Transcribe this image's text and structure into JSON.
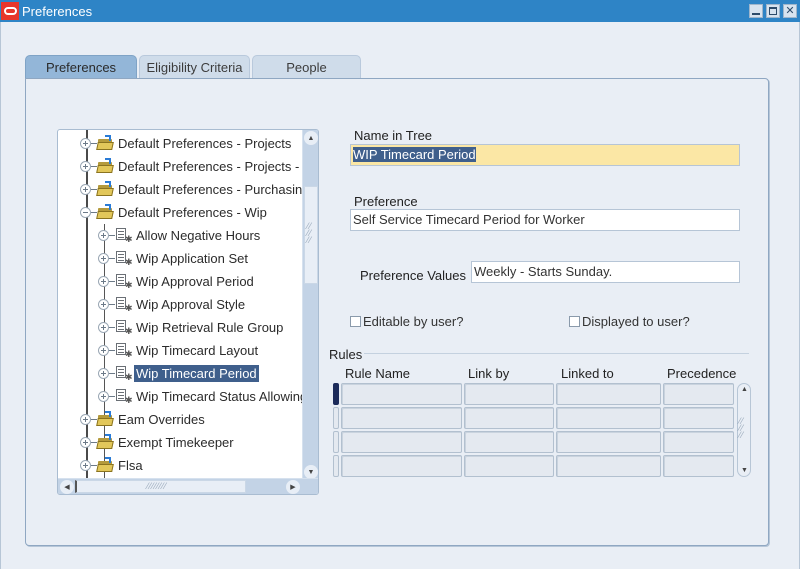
{
  "window": {
    "title": "Preferences",
    "controls": [
      "minimize",
      "maximize",
      "close"
    ]
  },
  "tabs": [
    {
      "label": "Preferences",
      "active": true
    },
    {
      "label": "Eligibility Criteria",
      "active": false
    },
    {
      "label": "People",
      "active": false
    }
  ],
  "tree": {
    "nodes": [
      {
        "label": "Default Preferences - Projects",
        "type": "folder",
        "expanded": false,
        "level": 0
      },
      {
        "label": "Default Preferences - Projects - F",
        "type": "folder",
        "expanded": false,
        "level": 0
      },
      {
        "label": "Default Preferences - Purchasing",
        "type": "folder",
        "expanded": false,
        "level": 0
      },
      {
        "label": "Default Preferences - Wip",
        "type": "folder",
        "expanded": true,
        "level": 0
      },
      {
        "label": "Allow Negative Hours",
        "type": "leaf",
        "level": 1
      },
      {
        "label": "Wip Application Set",
        "type": "leaf",
        "level": 1
      },
      {
        "label": "Wip Approval Period",
        "type": "leaf",
        "level": 1
      },
      {
        "label": "Wip Approval Style",
        "type": "leaf",
        "level": 1
      },
      {
        "label": "Wip Retrieval Rule Group",
        "type": "leaf",
        "level": 1
      },
      {
        "label": "Wip Timecard Layout",
        "type": "leaf",
        "level": 1
      },
      {
        "label": "Wip Timecard Period",
        "type": "leaf",
        "level": 1,
        "selected": true
      },
      {
        "label": "Wip Timecard Status Allowing",
        "type": "leaf",
        "level": 1
      },
      {
        "label": "Eam Overrides",
        "type": "folder",
        "expanded": false,
        "level": 0
      },
      {
        "label": "Exempt Timekeeper",
        "type": "folder",
        "expanded": false,
        "level": 0
      },
      {
        "label": "Flsa",
        "type": "folder",
        "expanded": false,
        "level": 0
      }
    ]
  },
  "form": {
    "name_in_tree_label": "Name in Tree",
    "name_in_tree_value": "WIP Timecard Period",
    "preference_label": "Preference",
    "preference_value": "Self Service Timecard Period for Worker",
    "preference_values_label": "Preference Values",
    "preference_values_value": "Weekly - Starts Sunday.",
    "editable_label": "Editable by user?",
    "editable_checked": false,
    "displayed_label": "Displayed to user?",
    "displayed_checked": false
  },
  "rules": {
    "section_label": "Rules",
    "columns": [
      "Rule Name",
      "Link by",
      "Linked to",
      "Precedence"
    ],
    "rows": [
      [
        "",
        "",
        "",
        ""
      ],
      [
        "",
        "",
        "",
        ""
      ],
      [
        "",
        "",
        "",
        ""
      ],
      [
        "",
        "",
        "",
        ""
      ]
    ]
  },
  "colors": {
    "titlebar": "#2e84c6",
    "selection": "#3f5f8c",
    "required_field": "#fbe7a5"
  }
}
